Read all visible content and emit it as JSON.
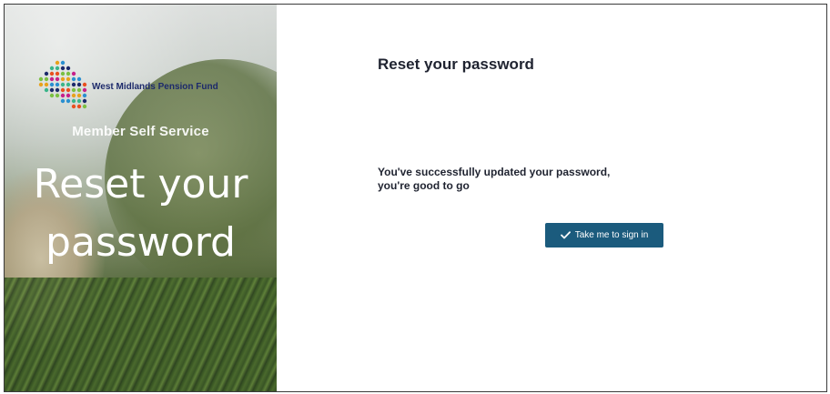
{
  "hero": {
    "brand_name": "West Midlands Pension Fund",
    "subtitle": "Member Self Service",
    "title_line1": "Reset your",
    "title_line2": "password",
    "logo_colors": [
      "#c7228a",
      "#e8a21c",
      "#2a8fd0",
      "#3bb58a",
      "#1d2a6b",
      "#e9501f",
      "#7bc043"
    ]
  },
  "panel": {
    "title": "Reset your password",
    "message_line1": "You've successfully updated your password,",
    "message_line2": "you're good to go",
    "button_label": "Take me to sign in",
    "button_icon": "check-icon",
    "accent_color": "#1b5b7d"
  }
}
